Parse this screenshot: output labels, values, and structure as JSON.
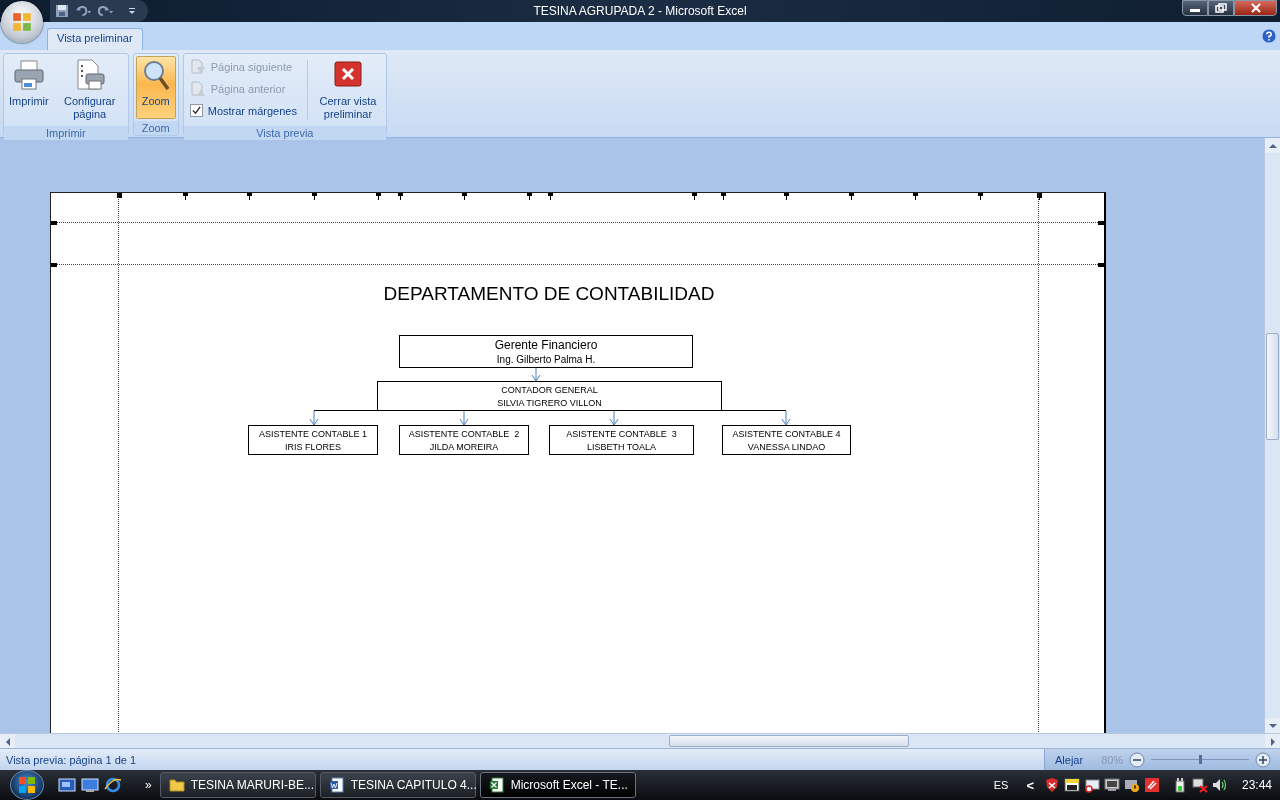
{
  "window": {
    "title": "TESINA AGRUPADA 2 - Microsoft Excel"
  },
  "tabs": [
    {
      "label": "Vista preliminar",
      "selected": true
    }
  ],
  "ribbon": {
    "groups": [
      {
        "label": "Imprimir",
        "items": [
          {
            "kind": "large",
            "label": "Imprimir",
            "selected": false
          },
          {
            "kind": "large",
            "label": "Configurar página",
            "selected": false
          }
        ]
      },
      {
        "label": "Zoom",
        "items": [
          {
            "kind": "large",
            "label": "Zoom",
            "selected": true
          }
        ]
      },
      {
        "label": "Vista previa",
        "items": [
          {
            "kind": "small",
            "label": "Página siguiente",
            "disabled": true
          },
          {
            "kind": "small",
            "label": "Página anterior",
            "disabled": true
          },
          {
            "kind": "checkbox",
            "label": "Mostrar márgenes",
            "checked": true
          },
          {
            "kind": "large",
            "label": "Cerrar vista preliminar",
            "selected": false
          }
        ]
      }
    ]
  },
  "org_chart": {
    "title": "DEPARTAMENTO DE CONTABILIDAD",
    "nodes": [
      {
        "role": "Gerente Financiero",
        "name": "Ing. Gilberto Palma H.",
        "children": [
          {
            "role": "CONTADOR GENERAL",
            "name": "SILVIA TIGRERO VILLON",
            "children": [
              {
                "role": "ASISTENTE CONTABLE 1",
                "name": "IRIS FLORES"
              },
              {
                "role": "ASISTENTE CONTABLE  2",
                "name": "JILDA MOREIRA"
              },
              {
                "role": "ASISTENTE CONTABLE  3",
                "name": "LISBETH TOALA"
              },
              {
                "role": "ASISTENTE CONTABLE 4",
                "name": "VANESSA LINDAO"
              }
            ]
          }
        ]
      }
    ]
  },
  "status_bar": {
    "text": "Vista previa: página 1 de 1",
    "zoom_out": "Alejar",
    "zoom": "80%",
    "zoom_slider": {
      "level": 0.5
    }
  },
  "taskbar": {
    "more": "»",
    "tasks": [
      {
        "label": "TESINA MARURI-BE...",
        "selected": false
      },
      {
        "label": "TESINA CAPITULO 4...",
        "selected": false
      },
      {
        "label": "Microsoft Excel - TE...",
        "selected": true
      }
    ],
    "language": "ES",
    "tray_toggle": "<",
    "clock": "23:44"
  }
}
